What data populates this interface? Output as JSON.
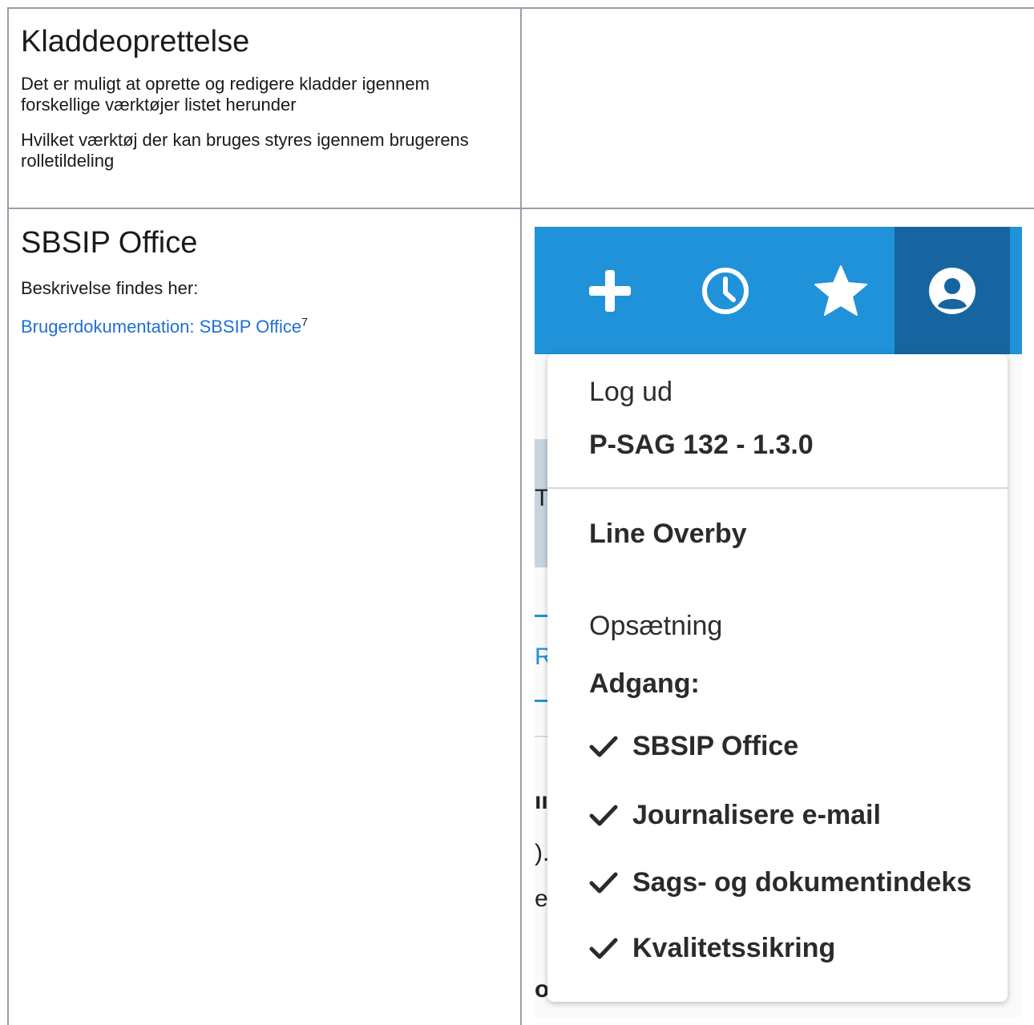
{
  "section1": {
    "title": "Kladdeoprettelse",
    "para1": "Det er muligt at oprette og redigere kladder igennem forskellige værktøjer listet herunder",
    "para2": "Hvilket værktøj der kan bruges styres igennem brugerens rolletildeling"
  },
  "section2": {
    "title": "SBSIP Office",
    "desc": "Beskrivelse findes her:",
    "link": "Brugerdokumentation: SBSIP Office",
    "footnote": "7"
  },
  "screenshot": {
    "colors": {
      "topbar": "#1f92d9",
      "active_tab": "#1765a0"
    },
    "toolbar_icons": [
      "plus-icon",
      "clock-icon",
      "star-icon",
      "user-circle-icon"
    ],
    "background_fragments": [
      "T",
      "R",
      "ıı",
      ").",
      "eS",
      "o"
    ],
    "menu": {
      "logout": "Log ud",
      "version": "P-SAG 132 - 1.3.0",
      "user": "Line Overby",
      "settings": "Opsætning",
      "access_heading": "Adgang:",
      "access_items": [
        "SBSIP Office",
        "Journalisere e-mail",
        "Sags- og dokumentindeks",
        "Kvalitetssikring"
      ]
    }
  }
}
